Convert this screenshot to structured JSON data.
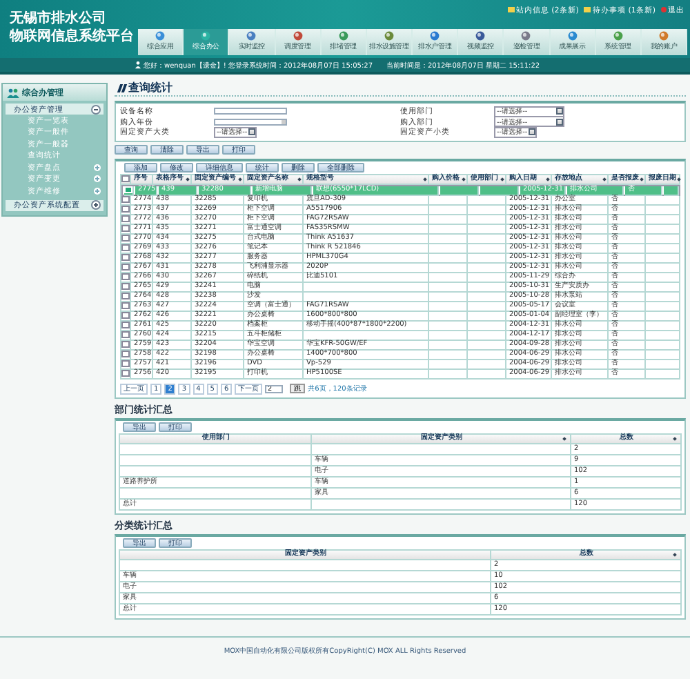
{
  "header": {
    "title_lines": [
      "无锡市排水公司",
      "物联网信息系统平台"
    ],
    "links": [
      {
        "label": "站内信息 (2条新)",
        "kind": "mail"
      },
      {
        "label": "待办事项 (1条新)",
        "kind": "mail"
      },
      {
        "label": "退出",
        "kind": "exit"
      }
    ],
    "nav": [
      {
        "label": "综合应用",
        "selected": false
      },
      {
        "label": "综合办公",
        "selected": true
      },
      {
        "label": "实时监控",
        "selected": false
      },
      {
        "label": "调度管理",
        "selected": false
      },
      {
        "label": "排堵管理",
        "selected": false
      },
      {
        "label": "排水设施管理",
        "selected": false
      },
      {
        "label": "排水户管理",
        "selected": false
      },
      {
        "label": "视频监控",
        "selected": false
      },
      {
        "label": "巡检管理",
        "selected": false
      },
      {
        "label": "成果展示",
        "selected": false
      },
      {
        "label": "系统管理",
        "selected": false
      },
      {
        "label": "我的账户",
        "selected": false
      }
    ],
    "status": "您好：wenquan【遗金】! 您登录系统时间：2012年08月07日 15:05:27　　当前时间是：2012年08月07日 星期二 15:11:22"
  },
  "sidebar": {
    "title": "综合办管理",
    "groups": [
      {
        "label": "办公资产管理",
        "expanded": true,
        "children": [
          {
            "label": "资产一览表",
            "kind": "link"
          },
          {
            "label": "资产一般件",
            "kind": "link"
          },
          {
            "label": "资产一般器",
            "kind": "link"
          },
          {
            "label": "查询统计",
            "kind": "link"
          },
          {
            "label": "资产盘点",
            "kind": "expandable"
          },
          {
            "label": "资产变更",
            "kind": "expandable"
          },
          {
            "label": "资产维修",
            "kind": "expandable"
          }
        ]
      },
      {
        "label": "办公资产系统配置",
        "expanded": false
      }
    ]
  },
  "page_title": "查询统计",
  "filters": {
    "left": [
      {
        "label": "设备名称",
        "kind": "text"
      },
      {
        "label": "购入年份",
        "kind": "date"
      },
      {
        "label": "固定资产大类",
        "kind": "select",
        "value": "--请选择--"
      }
    ],
    "right": [
      {
        "label": "使用部门",
        "kind": "select_wide",
        "value": "--请选择--"
      },
      {
        "label": "购入部门",
        "kind": "select_wide",
        "value": "--请选择--"
      },
      {
        "label": "固定资产小类",
        "kind": "select",
        "value": "--请选择--"
      }
    ]
  },
  "form_buttons": [
    "查询",
    "清除",
    "导出",
    "打印"
  ],
  "toolbar": [
    "添加",
    "修改",
    "详细信息",
    "统计",
    "删除",
    "全部删除"
  ],
  "table": {
    "select_all_checked": false,
    "columns": [
      {
        "label": "序号",
        "sortable": false
      },
      {
        "label": "表格序号",
        "sortable": true
      },
      {
        "label": "固定资产编号",
        "sortable": true
      },
      {
        "label": "固定资产名称",
        "sortable": true
      },
      {
        "label": "规格型号",
        "sortable": true
      },
      {
        "label": "购入价格",
        "sortable": true
      },
      {
        "label": "使用部门",
        "sortable": true
      },
      {
        "label": "购入日期",
        "sortable": true
      },
      {
        "label": "存放地点",
        "sortable": true
      },
      {
        "label": "是否报废",
        "sortable": true
      },
      {
        "label": "报废日期",
        "sortable": true
      }
    ],
    "rows": [
      {
        "selected": true,
        "checked": true,
        "cells": [
          "2775",
          "439",
          "32280",
          "新增电脑",
          "联想(6550*17LCD)",
          "",
          "",
          "2005-12-31",
          "排水公司",
          "否",
          ""
        ]
      },
      {
        "selected": false,
        "checked": false,
        "cells": [
          "2774",
          "438",
          "32285",
          "复印机",
          "震旦AD-309",
          "",
          "",
          "2005-12-31",
          "办公室",
          "否",
          ""
        ]
      },
      {
        "selected": false,
        "checked": false,
        "cells": [
          "2773",
          "437",
          "32269",
          "柜下空调",
          "A5517906",
          "",
          "",
          "2005-12-31",
          "排水公司",
          "否",
          ""
        ]
      },
      {
        "selected": false,
        "checked": false,
        "cells": [
          "2772",
          "436",
          "32270",
          "柜下空调",
          "FAG72RSAW",
          "",
          "",
          "2005-12-31",
          "排水公司",
          "否",
          ""
        ]
      },
      {
        "selected": false,
        "checked": false,
        "cells": [
          "2771",
          "435",
          "32271",
          "富士通空调",
          "FAS35RSMW",
          "",
          "",
          "2005-12-31",
          "排水公司",
          "否",
          ""
        ]
      },
      {
        "selected": false,
        "checked": false,
        "cells": [
          "2770",
          "434",
          "32275",
          "台式电脑",
          "Think A51637",
          "",
          "",
          "2005-12-31",
          "排水公司",
          "否",
          ""
        ]
      },
      {
        "selected": false,
        "checked": false,
        "cells": [
          "2769",
          "433",
          "32276",
          "笔记本",
          "Think R 521846",
          "",
          "",
          "2005-12-31",
          "排水公司",
          "否",
          ""
        ]
      },
      {
        "selected": false,
        "checked": false,
        "cells": [
          "2768",
          "432",
          "32277",
          "服务器",
          "HPML370G4",
          "",
          "",
          "2005-12-31",
          "排水公司",
          "否",
          ""
        ]
      },
      {
        "selected": false,
        "checked": false,
        "cells": [
          "2767",
          "431",
          "32278",
          "飞利浦显示器",
          "2020P",
          "",
          "",
          "2005-12-31",
          "排水公司",
          "否",
          ""
        ]
      },
      {
        "selected": false,
        "checked": false,
        "cells": [
          "2766",
          "430",
          "32267",
          "碎纸机",
          "比迪5101",
          "",
          "",
          "2005-11-29",
          "综合办",
          "否",
          ""
        ]
      },
      {
        "selected": false,
        "checked": false,
        "cells": [
          "2765",
          "429",
          "32241",
          "电脑",
          "",
          "",
          "",
          "2005-10-31",
          "生产安质办",
          "否",
          ""
        ]
      },
      {
        "selected": false,
        "checked": false,
        "cells": [
          "2764",
          "428",
          "32238",
          "沙发",
          "",
          "",
          "",
          "2005-10-28",
          "排水泵站",
          "否",
          ""
        ]
      },
      {
        "selected": false,
        "checked": false,
        "cells": [
          "2763",
          "427",
          "32224",
          "空调（富士通）",
          "FAG71RSAW",
          "",
          "",
          "2005-05-17",
          "会议室",
          "否",
          ""
        ]
      },
      {
        "selected": false,
        "checked": false,
        "cells": [
          "2762",
          "426",
          "32221",
          "办公桌椅",
          "1600*800*800",
          "",
          "",
          "2005-01-04",
          "副经理室（李）",
          "否",
          ""
        ]
      },
      {
        "selected": false,
        "checked": false,
        "cells": [
          "2761",
          "425",
          "32220",
          "档案柜",
          "移动手摇(400*87*1800*2200)",
          "",
          "",
          "2004-12-31",
          "排水公司",
          "否",
          ""
        ]
      },
      {
        "selected": false,
        "checked": false,
        "cells": [
          "2760",
          "424",
          "32215",
          "五斗柜储柜",
          "",
          "",
          "",
          "2004-12-17",
          "排水公司",
          "否",
          ""
        ]
      },
      {
        "selected": false,
        "checked": false,
        "cells": [
          "2759",
          "423",
          "32204",
          "华宝空调",
          "华宝KFR-50GW/EF",
          "",
          "",
          "2004-09-28",
          "排水公司",
          "否",
          ""
        ]
      },
      {
        "selected": false,
        "checked": false,
        "cells": [
          "2758",
          "422",
          "32198",
          "办公桌椅",
          "1400*700*800",
          "",
          "",
          "2004-06-29",
          "排水公司",
          "否",
          ""
        ]
      },
      {
        "selected": false,
        "checked": false,
        "cells": [
          "2757",
          "421",
          "32196",
          "DVD",
          "Vp-529",
          "",
          "",
          "2004-06-29",
          "排水公司",
          "否",
          ""
        ]
      },
      {
        "selected": false,
        "checked": false,
        "cells": [
          "2756",
          "420",
          "32195",
          "打印机",
          "HP5100SE",
          "",
          "",
          "2004-06-29",
          "排水公司",
          "否",
          ""
        ]
      }
    ]
  },
  "pager": {
    "prev": "上一页",
    "pages": [
      {
        "label": "1",
        "selected": false
      },
      {
        "label": "2",
        "selected": true
      },
      {
        "label": "3",
        "selected": false
      },
      {
        "label": "4",
        "selected": false
      },
      {
        "label": "5",
        "selected": false
      },
      {
        "label": "6",
        "selected": false
      }
    ],
    "next": "下一页",
    "jump_value": "2",
    "go": "跳",
    "summary": "共6页，120条记录"
  },
  "dept_summary": {
    "title": "部门统计汇总",
    "buttons": [
      "导出",
      "打印"
    ],
    "columns": [
      {
        "label": "使用部门",
        "sortable": false
      },
      {
        "label": "固定资产类别",
        "sortable": true
      },
      {
        "label": "总数",
        "sortable": true
      }
    ],
    "rows": [
      [
        "",
        "",
        "2"
      ],
      [
        "",
        "车辆",
        "9"
      ],
      [
        "",
        "电子",
        "102"
      ],
      [
        "道路养护所",
        "车辆",
        "1"
      ],
      [
        "",
        "家具",
        "6"
      ],
      [
        "总计",
        "",
        "120"
      ]
    ]
  },
  "category_summary": {
    "title": "分类统计汇总",
    "buttons": [
      "导出",
      "打印"
    ],
    "columns": [
      {
        "label": "固定资产类别",
        "sortable": false
      },
      {
        "label": "总数",
        "sortable": true
      }
    ],
    "rows": [
      [
        "",
        "2"
      ],
      [
        "车辆",
        "10"
      ],
      [
        "电子",
        "102"
      ],
      [
        "家具",
        "6"
      ],
      [
        "总计",
        "120"
      ]
    ]
  },
  "footer": "MOX中国自动化有限公司版权所有CopyRight(C) MOX ALL Rights Reserved"
}
